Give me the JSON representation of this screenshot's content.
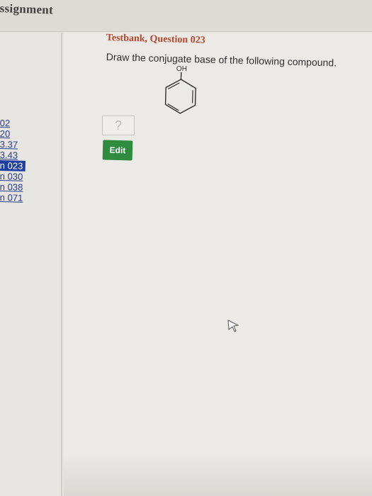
{
  "header": {
    "title": "ssignment"
  },
  "sidebar": {
    "items": [
      {
        "label": "02",
        "active": false
      },
      {
        "label": "20",
        "active": false
      },
      {
        "label": "3.37",
        "active": false
      },
      {
        "label": "3.43",
        "active": false
      },
      {
        "label": "n 023",
        "active": true
      },
      {
        "label": "n 030",
        "active": false
      },
      {
        "label": "n 038",
        "active": false
      },
      {
        "label": "n 071",
        "active": false
      }
    ]
  },
  "question": {
    "title": "Testbank, Question 023",
    "prompt": "Draw the conjugate base of the following compound.",
    "structure_label": "OH"
  },
  "controls": {
    "help_label": "?",
    "edit_label": "Edit"
  },
  "colors": {
    "edit_button": "#2f8b3e",
    "question_title": "#b8442c",
    "active_sidebar": "#1f3fa0"
  }
}
